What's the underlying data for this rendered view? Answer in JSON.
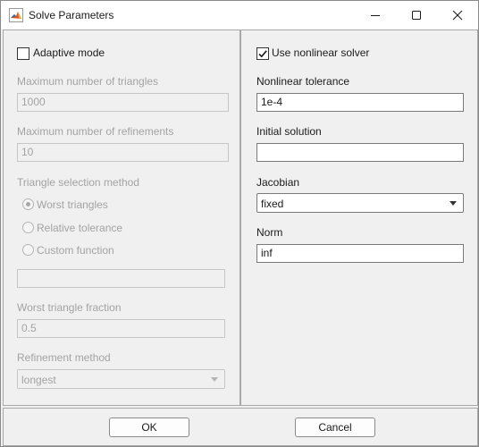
{
  "window": {
    "title": "Solve Parameters"
  },
  "left": {
    "adaptive_mode": {
      "label": "Adaptive mode",
      "checked": false
    },
    "max_triangles": {
      "label": "Maximum number of triangles",
      "value": "1000"
    },
    "max_refinements": {
      "label": "Maximum number of refinements",
      "value": "10"
    },
    "selection_method": {
      "label": "Triangle selection method",
      "options": [
        "Worst triangles",
        "Relative tolerance",
        "Custom function"
      ],
      "selected": "Worst triangles"
    },
    "custom_function": {
      "value": ""
    },
    "worst_fraction": {
      "label": "Worst triangle fraction",
      "value": "0.5"
    },
    "refinement_method": {
      "label": "Refinement method",
      "value": "longest"
    }
  },
  "right": {
    "nonlinear": {
      "label": "Use nonlinear solver",
      "checked": true
    },
    "tolerance": {
      "label": "Nonlinear tolerance",
      "value": "1e-4"
    },
    "initial_solution": {
      "label": "Initial solution",
      "value": ""
    },
    "jacobian": {
      "label": "Jacobian",
      "value": "fixed"
    },
    "norm": {
      "label": "Norm",
      "value": "inf"
    }
  },
  "buttons": {
    "ok": "OK",
    "cancel": "Cancel"
  },
  "colors": {
    "disabled_text": "#a3a3a3",
    "background": "#f0f0f0",
    "titlebar": "#ffffff"
  },
  "icons": {
    "app": "matlab-logo-icon",
    "minimize": "minimize-icon",
    "maximize": "maximize-icon",
    "close": "close-icon",
    "dropdown": "chevron-down-icon",
    "check": "checkmark-icon"
  }
}
